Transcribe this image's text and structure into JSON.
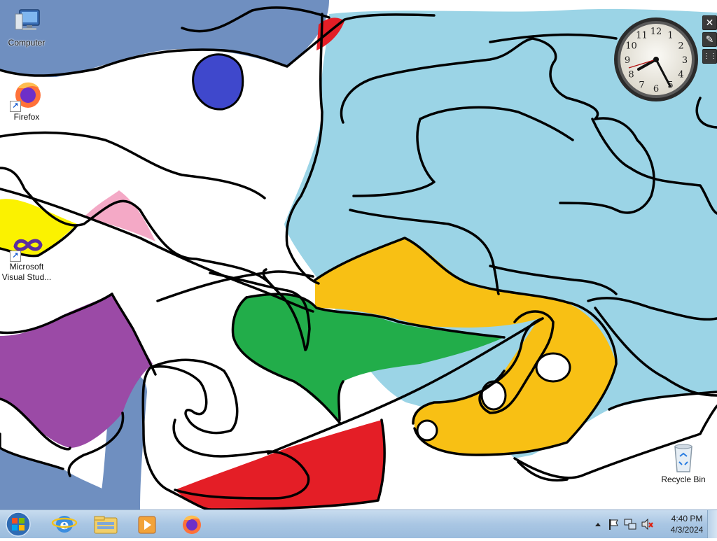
{
  "desktop": {
    "icons": [
      {
        "label": "Computer",
        "icon": "computer-icon"
      },
      {
        "label": "Firefox",
        "icon": "firefox-icon"
      },
      {
        "label": "Microsoft Visual Stud...",
        "icon": "visual-studio-icon"
      },
      {
        "label": "Recycle Bin",
        "icon": "recycle-bin-icon"
      }
    ]
  },
  "gadget": {
    "type": "clock",
    "numbers": [
      "12",
      "1",
      "2",
      "3",
      "4",
      "5",
      "6",
      "7",
      "8",
      "9",
      "10",
      "11"
    ],
    "tools": [
      "close-icon",
      "settings-wrench-icon",
      "drag-handle-icon"
    ]
  },
  "taskbar": {
    "pinned": [
      "internet-explorer-icon",
      "windows-explorer-icon",
      "media-player-icon",
      "firefox-icon"
    ],
    "tray": {
      "icons": [
        "show-hidden-icons-icon",
        "action-center-flag-icon",
        "network-icon",
        "volume-muted-icon"
      ],
      "time": "4:40 PM",
      "date": "4/3/2024"
    }
  },
  "colors": {
    "taskbar": "#a9c6e3",
    "wallpaper_light_blue": "#9bd4e6",
    "wallpaper_slate": "#6f8fc0",
    "wallpaper_orange": "#f8c014",
    "wallpaper_green": "#22ad4a",
    "wallpaper_red": "#e41e26",
    "wallpaper_purple": "#9b4aa6",
    "wallpaper_yellow": "#fbf200",
    "wallpaper_pink": "#f4a9c6",
    "wallpaper_blue": "#3f48cc"
  }
}
